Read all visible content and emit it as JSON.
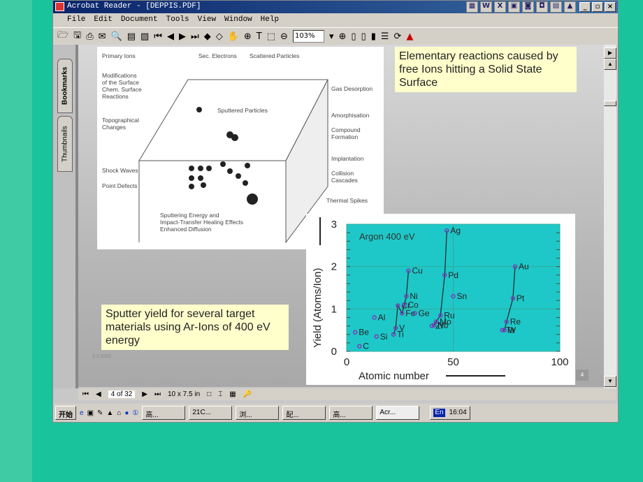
{
  "window": {
    "title": "Acrobat Reader - [DEPPIS.PDF]",
    "controls": [
      "_",
      "▫",
      "×"
    ]
  },
  "menu": [
    "File",
    "Edit",
    "Document",
    "Tools",
    "View",
    "Window",
    "Help"
  ],
  "toolbar": {
    "zoom": "103%"
  },
  "nav_tabs": [
    "Bookmarks",
    "Thumbnails"
  ],
  "slide": {
    "note_top": "Elementary reactions caused by free Ions hitting a Solid State Surface",
    "note_bottom": "Sputter yield for several target materials using Ar-Ions of 400 eV energy",
    "date": "2.2.2002",
    "page_badge": "4",
    "diagram": {
      "labels": [
        "Primary Ions",
        "Sec. Electrons",
        "Scattered Particles",
        "Modifications\nof the Surface\nChem. Surface\nReactions",
        "Gas Desorption",
        "Sputtered Particles",
        "Topographical\nChanges",
        "Amorphisation",
        "Compound\nFormation",
        "Implantation",
        "Shock Waves",
        "Collision\nCascades",
        "Point Defects",
        "Thermal Spikes",
        "Sputtering Energy and\nImpact-Transfer Healing Effects\nEnhanced Diffusion"
      ]
    }
  },
  "chart_data": {
    "type": "scatter",
    "annotation": "Argon 400 eV",
    "xlabel": "Atomic number",
    "ylabel": "Yield (Atoms/Ion)",
    "xlim": [
      0,
      100
    ],
    "ylim": [
      0,
      3
    ],
    "xticks": [
      0,
      50,
      100
    ],
    "yticks": [
      0,
      1,
      2,
      3
    ],
    "grid": true,
    "background": "#1ec8c8",
    "marker_color": "#7a3db8",
    "points": [
      {
        "label": "Be",
        "x": 4,
        "y": 0.45
      },
      {
        "label": "C",
        "x": 6,
        "y": 0.12
      },
      {
        "label": "Al",
        "x": 13,
        "y": 0.8
      },
      {
        "label": "Si",
        "x": 14,
        "y": 0.35
      },
      {
        "label": "Ti",
        "x": 22,
        "y": 0.4
      },
      {
        "label": "V",
        "x": 23,
        "y": 0.55
      },
      {
        "label": "Cr",
        "x": 24,
        "y": 1.08
      },
      {
        "label": "Fe",
        "x": 26,
        "y": 0.9
      },
      {
        "label": "Co",
        "x": 27,
        "y": 1.1
      },
      {
        "label": "Ni",
        "x": 28,
        "y": 1.3
      },
      {
        "label": "Cu",
        "x": 29,
        "y": 1.9
      },
      {
        "label": "Ge",
        "x": 32,
        "y": 0.9
      },
      {
        "label": "Zr",
        "x": 40,
        "y": 0.6
      },
      {
        "label": "Nb",
        "x": 41,
        "y": 0.62
      },
      {
        "label": "Mo",
        "x": 42,
        "y": 0.7
      },
      {
        "label": "Ru",
        "x": 44,
        "y": 0.85
      },
      {
        "label": "Pd",
        "x": 46,
        "y": 1.8
      },
      {
        "label": "Ag",
        "x": 47,
        "y": 2.85
      },
      {
        "label": "Sn",
        "x": 50,
        "y": 1.3
      },
      {
        "label": "Ta",
        "x": 73,
        "y": 0.5
      },
      {
        "label": "W",
        "x": 74,
        "y": 0.5
      },
      {
        "label": "Re",
        "x": 75,
        "y": 0.7
      },
      {
        "label": "Pt",
        "x": 78,
        "y": 1.25
      },
      {
        "label": "Au",
        "x": 79,
        "y": 2.0
      }
    ],
    "lines": [
      [
        "Ti",
        "V",
        "Cr",
        "Fe",
        "Co",
        "Ni",
        "Cu"
      ],
      [
        "Zr",
        "Nb",
        "Mo",
        "Ru",
        "Pd",
        "Ag"
      ],
      [
        "Ta",
        "W",
        "Re",
        "Pt",
        "Au"
      ]
    ]
  },
  "status": {
    "page": "4 of 32",
    "size": "10 x 7.5 in"
  },
  "taskbar": {
    "start": "开始",
    "items": [
      "高...",
      "21C...",
      "浏...",
      "配...",
      "高...",
      "Acr..."
    ],
    "lang": "En",
    "clock": "16:04"
  }
}
